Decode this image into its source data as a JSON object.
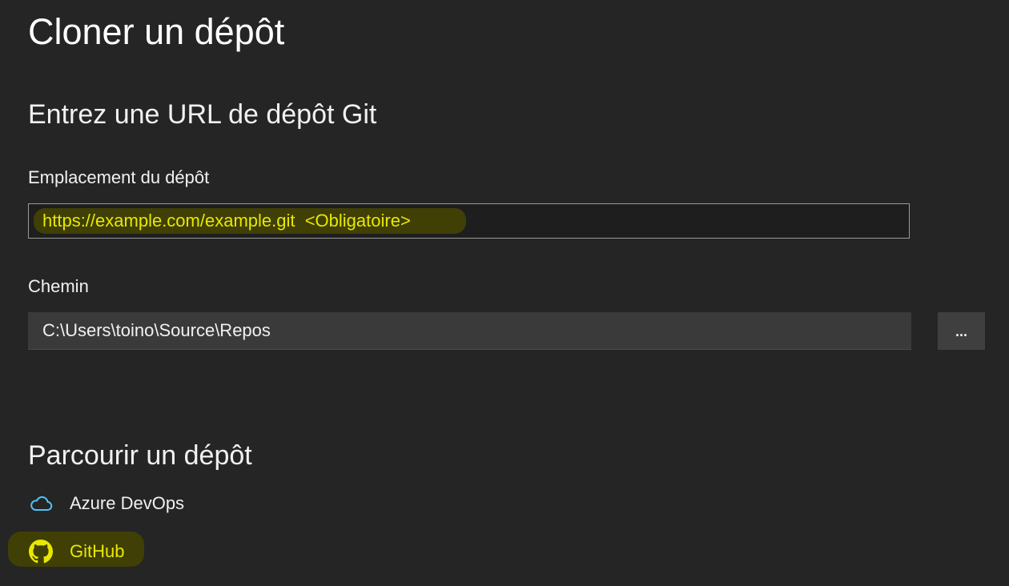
{
  "page": {
    "title": "Cloner un dépôt"
  },
  "url_section": {
    "heading": "Entrez une URL de dépôt Git",
    "location_label": "Emplacement du dépôt",
    "location_placeholder": "https://example.com/example.git  <Obligatoire>",
    "path_label": "Chemin",
    "path_value": "C:\\Users\\toino\\Source\\Repos",
    "browse_button_label": "..."
  },
  "browse_section": {
    "heading": "Parcourir un dépôt",
    "providers": [
      {
        "label": "Azure DevOps",
        "icon": "cloud-icon"
      },
      {
        "label": "GitHub",
        "icon": "github-icon"
      }
    ]
  },
  "colors": {
    "background": "#252526",
    "highlight_text": "#e8e800",
    "highlight_background": "#3f3f06",
    "azure_icon": "#4fc3f7"
  }
}
